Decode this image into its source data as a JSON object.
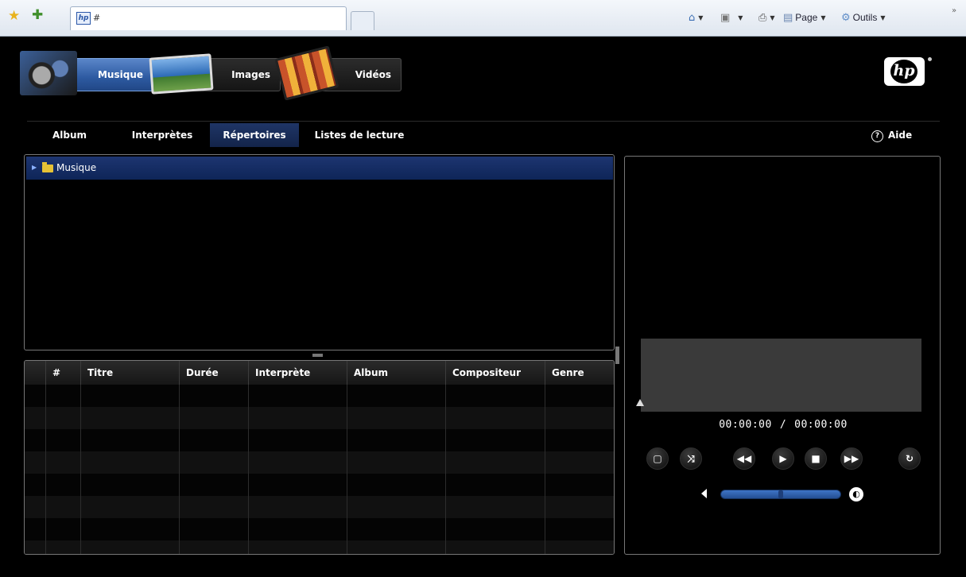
{
  "browser": {
    "tab_title": "#",
    "commands": {
      "page_label": "Page",
      "tools_label": "Outils"
    },
    "icons": [
      "favorites-star-icon",
      "add-favorite-icon",
      "home-icon",
      "feeds-icon",
      "print-icon",
      "page-icon",
      "tools-gear-icon"
    ]
  },
  "media_tabs": [
    {
      "label": "Musique",
      "icon": "headphones-icon",
      "active": true
    },
    {
      "label": "Images",
      "icon": "photo-icon",
      "active": false
    },
    {
      "label": "Vidéos",
      "icon": "film-icon",
      "active": false
    }
  ],
  "brand": {
    "logo_text": "hp"
  },
  "sub_tabs": [
    {
      "label": "Album",
      "active": false
    },
    {
      "label": "Interprètes",
      "active": false
    },
    {
      "label": "Répertoires",
      "active": true
    },
    {
      "label": "Listes de lecture",
      "active": false
    }
  ],
  "help": {
    "label": "Aide",
    "icon_glyph": "?"
  },
  "tree": {
    "items": [
      {
        "label": "Musique",
        "icon": "folder-icon",
        "selected": true
      }
    ]
  },
  "tracks": {
    "columns": [
      "#",
      "Titre",
      "Durée",
      "Interprète",
      "Album",
      "Compositeur",
      "Genre"
    ],
    "rows": []
  },
  "player": {
    "elapsed": "00:00:00",
    "separator": "/",
    "total": "00:00:00",
    "volume": 0.5,
    "controls": [
      "fullscreen-icon",
      "shuffle-icon",
      "rewind-icon",
      "play-icon",
      "stop-icon",
      "fast-forward-icon",
      "repeat-icon"
    ]
  },
  "colors": {
    "accent_blue": "#2d5aa1",
    "selected_row": "#0e2558",
    "background": "#000000"
  }
}
